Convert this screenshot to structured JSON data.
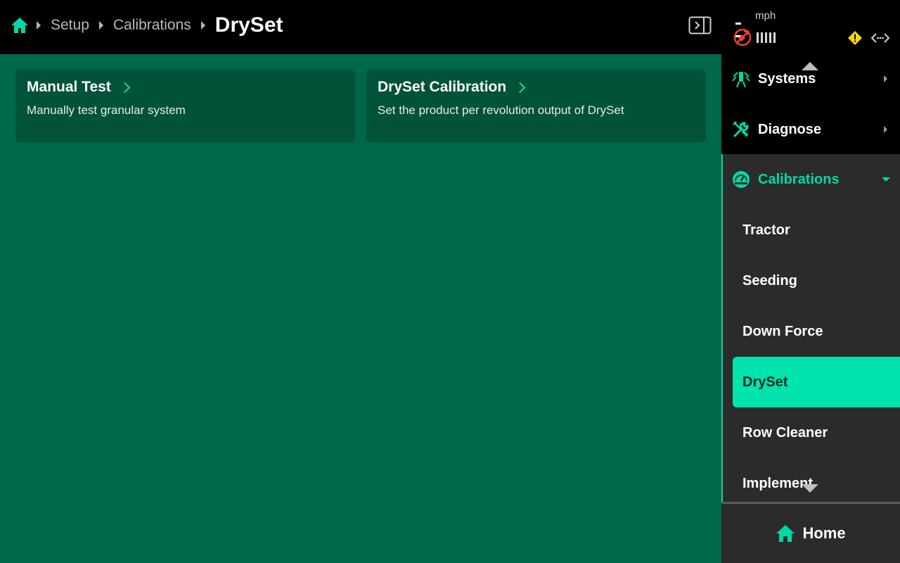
{
  "colors": {
    "accent": "#00d9a5",
    "main_bg": "#00674a",
    "card_bg": "#005238",
    "panel_bg": "#2b2b2b",
    "warning": "#f5d900",
    "alert": "#e8412b"
  },
  "header": {
    "breadcrumb": [
      "Setup",
      "Calibrations"
    ],
    "current": "DrySet",
    "home_icon": "home-icon",
    "toggle_icon": "panel-toggle-icon"
  },
  "cards": [
    {
      "title": "Manual Test",
      "description": "Manually test granular system"
    },
    {
      "title": "DrySet Calibration",
      "description": "Set the product per revolution output of DrySet"
    }
  ],
  "status": {
    "speed_value": "--",
    "speed_unit": "mph",
    "gps_icon": "gps-lost-icon",
    "warning_icon": "warning-icon",
    "connection_icon": "connection-icon"
  },
  "nav": {
    "top_items": [
      {
        "label": "Systems",
        "icon": "systems-icon"
      },
      {
        "label": "Diagnose",
        "icon": "wrench-icon"
      }
    ],
    "expanded": {
      "label": "Calibrations",
      "icon": "gauge-icon"
    },
    "sub_items": [
      "Tractor",
      "Seeding",
      "Down Force",
      "DrySet",
      "Row Cleaner",
      "Implement"
    ],
    "active_sub": "DrySet"
  },
  "home_bar": {
    "label": "Home"
  }
}
